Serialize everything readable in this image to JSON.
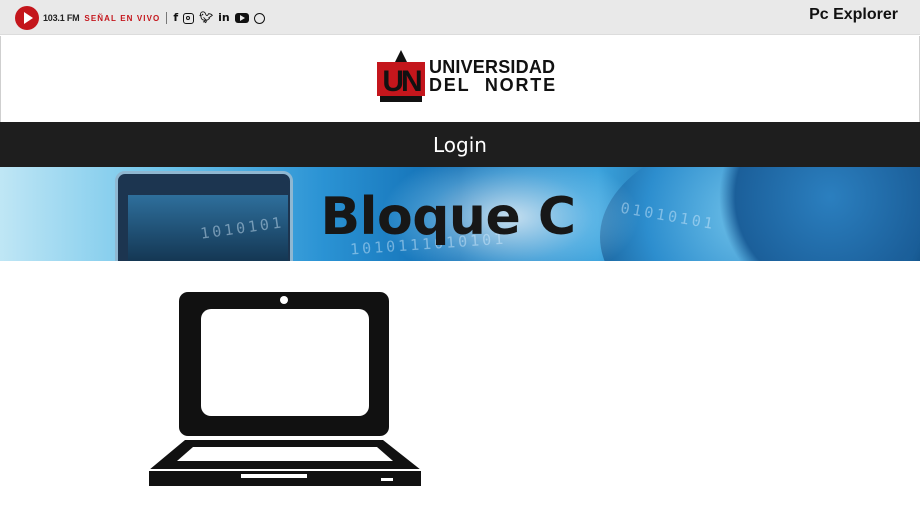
{
  "topbar": {
    "radio_frequency": "103.1 FM",
    "radio_status": "SEÑAL EN VIVO",
    "social_icons": [
      "facebook-icon",
      "instagram-icon",
      "twitter-icon",
      "linkedin-icon",
      "youtube-icon",
      "whatsapp-icon"
    ],
    "user_label": "Pc Explorer"
  },
  "logo": {
    "mark": "UN",
    "line1": "UNIVERSIDAD",
    "line2": "DEL NORTE",
    "brand_color": "#c4161c"
  },
  "nav": {
    "login_label": "Login"
  },
  "banner": {
    "title": "Bloque C",
    "binary_text_1": "1010101",
    "binary_text_2": "1010111010101",
    "binary_text_3": "01010101"
  },
  "content": {
    "icon": "laptop-icon"
  }
}
